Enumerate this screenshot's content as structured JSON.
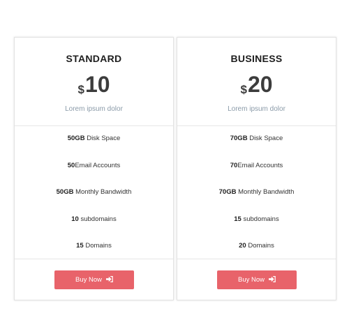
{
  "plans": [
    {
      "name": "STANDARD",
      "currency": "$",
      "amount": "10",
      "subtitle": "Lorem ipsum dolor",
      "features": [
        {
          "value": "50GB",
          "label": " Disk Space"
        },
        {
          "value": "50",
          "label": "Email Accounts"
        },
        {
          "value": "50GB",
          "label": " Monthly Bandwidth"
        },
        {
          "value": "10",
          "label": " subdomains"
        },
        {
          "value": "15",
          "label": " Domains"
        }
      ],
      "button_label": "Buy Now",
      "button_icon": "sign-in-icon"
    },
    {
      "name": "BUSINESS",
      "currency": "$",
      "amount": "20",
      "subtitle": "Lorem ipsum dolor",
      "features": [
        {
          "value": "70GB",
          "label": " Disk Space"
        },
        {
          "value": "70",
          "label": "Email Accounts"
        },
        {
          "value": "70GB",
          "label": " Monthly Bandwidth"
        },
        {
          "value": "15",
          "label": " subdomains"
        },
        {
          "value": "20",
          "label": " Domains"
        }
      ],
      "button_label": "Buy Now",
      "button_icon": "sign-in-icon"
    }
  ],
  "colors": {
    "button": "#e8636a",
    "subtitle": "#8a9aa8",
    "price": "#3c3c3c"
  }
}
